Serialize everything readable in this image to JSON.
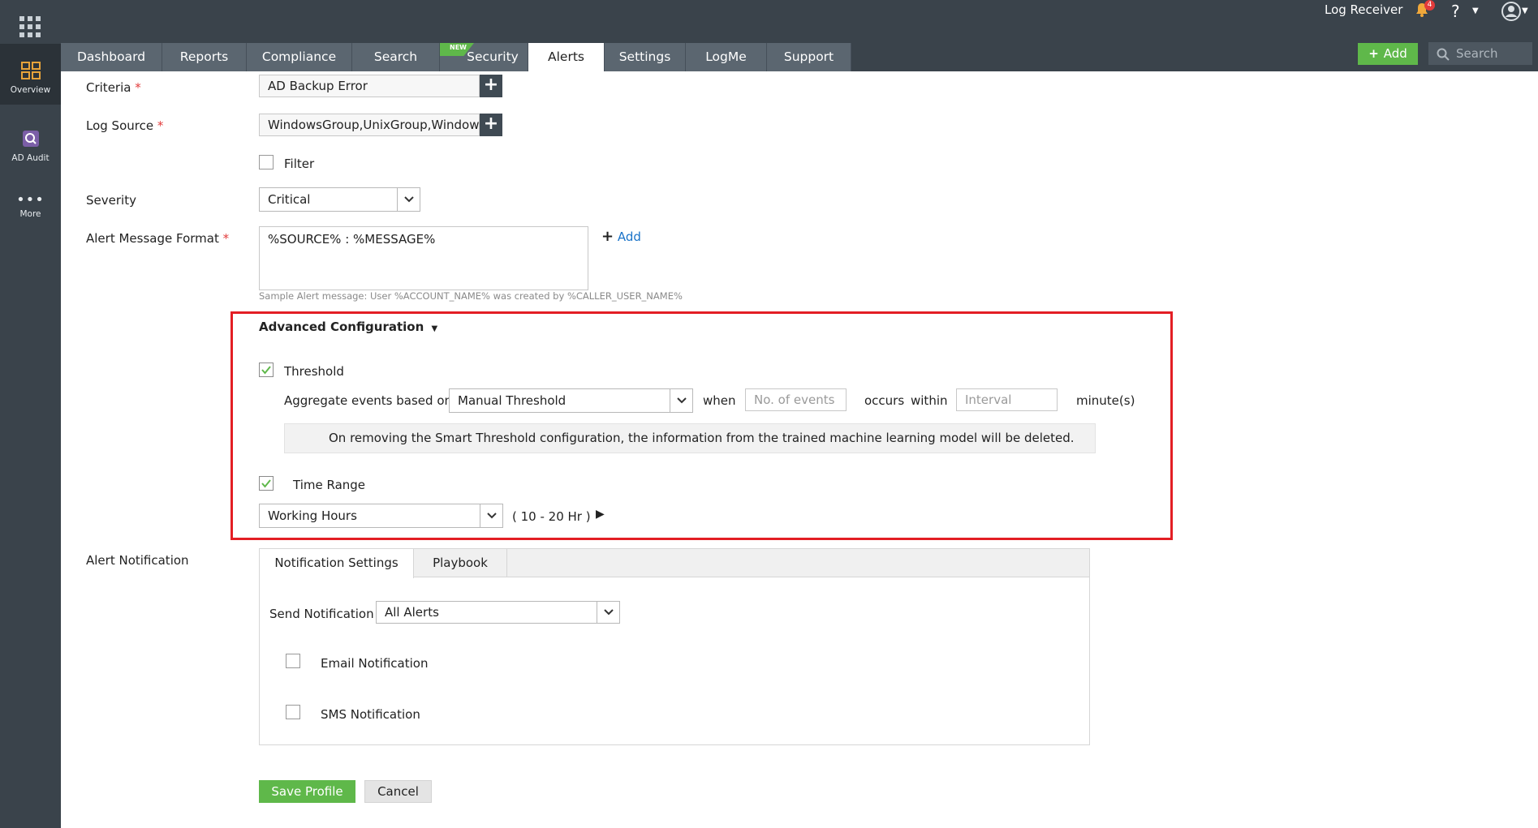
{
  "rail": {
    "items": [
      {
        "label": "Overview"
      },
      {
        "label": "AD Audit"
      },
      {
        "label": "More"
      }
    ]
  },
  "header": {
    "log_receiver": "Log Receiver",
    "notification_count": "4",
    "help": "?",
    "add_label": "Add",
    "search_placeholder": "Search"
  },
  "nav": {
    "tabs": [
      {
        "label": "Dashboard"
      },
      {
        "label": "Reports"
      },
      {
        "label": "Compliance"
      },
      {
        "label": "Search"
      },
      {
        "label": "Security",
        "flag": "NEW"
      },
      {
        "label": "Alerts",
        "active": true
      },
      {
        "label": "Settings"
      },
      {
        "label": "LogMe"
      },
      {
        "label": "Support"
      }
    ]
  },
  "form": {
    "criteria_label": "Criteria",
    "criteria_value": "AD Backup Error",
    "log_source_label": "Log Source",
    "log_source_value": "WindowsGroup,UnixGroup,Windows",
    "filter_label": "Filter",
    "severity_label": "Severity",
    "severity_value": "Critical",
    "amf_label": "Alert Message Format",
    "amf_value": "%SOURCE% : %MESSAGE%",
    "amf_add": "Add",
    "sample_message": "Sample Alert message: User %ACCOUNT_NAME% was created by %CALLER_USER_NAME%",
    "required_mark": "*"
  },
  "advanced": {
    "title": "Advanced Configuration",
    "threshold_label": "Threshold",
    "threshold_checked": true,
    "aggregate_label": "Aggregate events based on",
    "aggregate_value": "Manual Threshold",
    "when_label": "when",
    "events_placeholder": "No. of events",
    "occurs_label": "occurs",
    "within_label": "within",
    "interval_placeholder": "Interval",
    "minutes_label": "minute(s)",
    "info_message": "On removing the Smart Threshold configuration, the information from the trained machine learning model will be deleted.",
    "time_range_label": "Time Range",
    "time_range_checked": true,
    "time_range_value": "Working Hours",
    "time_range_hours": "( 10 - 20 Hr )"
  },
  "notification": {
    "label": "Alert Notification",
    "tabs": [
      {
        "label": "Notification Settings",
        "active": true
      },
      {
        "label": "Playbook"
      }
    ],
    "send_label": "Send Notification",
    "send_value": "All Alerts",
    "email_label": "Email Notification",
    "sms_label": "SMS Notification"
  },
  "actions": {
    "save_label": "Save Profile",
    "cancel_label": "Cancel"
  },
  "colors": {
    "accent_green": "#5fb84a",
    "header_bg": "#3a434b",
    "highlight_red": "#e31e24"
  }
}
